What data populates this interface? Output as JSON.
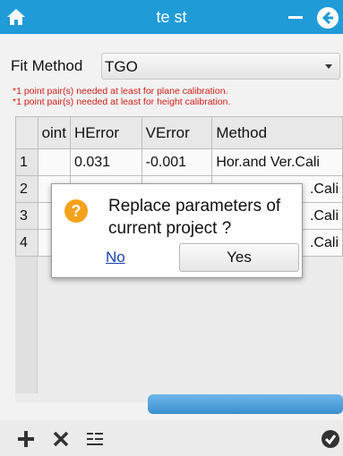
{
  "header": {
    "title": "te st",
    "bg_color": "#1f9bd8",
    "icons": [
      "home-icon",
      "minimize-icon",
      "back-icon"
    ]
  },
  "fit": {
    "label": "Fit Method",
    "value": "TGO"
  },
  "warnings": [
    "*1 point pair(s) needed at least for plane calibration.",
    "*1 point pair(s) needed at least for height calibration."
  ],
  "table": {
    "headers": [
      "",
      "oint",
      "HError",
      "VError",
      "Method"
    ],
    "rows": [
      [
        "1",
        "",
        "0.031",
        "-0.001",
        "Hor.and Ver.Cali"
      ],
      [
        "2",
        "",
        "",
        "",
        ".Cali"
      ],
      [
        "3",
        "",
        "",
        "",
        ".Cali"
      ],
      [
        "4",
        "",
        "",
        "",
        ".Cali"
      ]
    ]
  },
  "dialog": {
    "message": "Replace parameters of current project ?",
    "no_label": "No",
    "yes_label": "Yes",
    "icon": "question-icon",
    "icon_color": "#f5a21b"
  },
  "footer": {
    "icons": [
      "plus-icon",
      "delete-icon",
      "list-icon",
      "confirm-icon"
    ]
  }
}
